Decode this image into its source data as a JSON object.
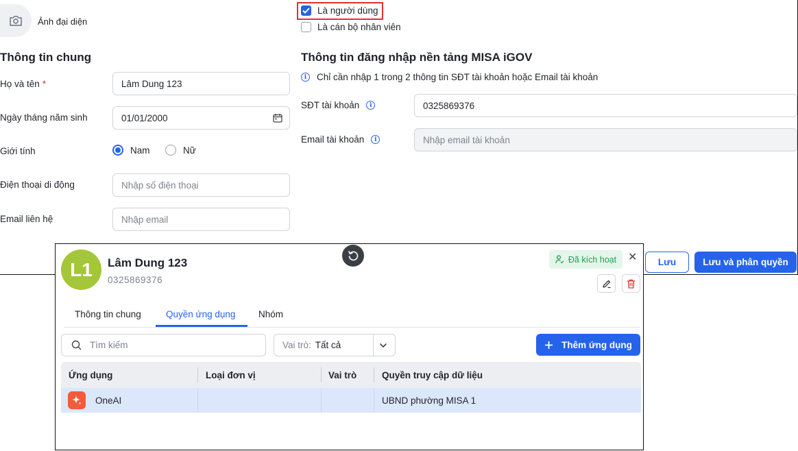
{
  "avatar": {
    "label": "Ảnh đại diện",
    "icon": "camera-icon"
  },
  "user_type": {
    "is_user_label": "Là người dùng",
    "is_user_checked": true,
    "is_staff_label": "Là cán bộ nhân viên",
    "is_staff_checked": false
  },
  "general": {
    "title": "Thông tin chung",
    "full_name_label": "Họ và tên",
    "required_mark": "*",
    "full_name_value": "Lâm Dung 123",
    "dob_label": "Ngày tháng năm sinh",
    "dob_value": "01/01/2000",
    "gender_label": "Giới tính",
    "gender_male": "Nam",
    "gender_female": "Nữ",
    "gender_selected": "Nam",
    "mobile_label": "Điện thoại di động",
    "mobile_placeholder": "Nhập số điện thoại",
    "email_label": "Email liên hệ",
    "email_placeholder": "Nhập email"
  },
  "login": {
    "title": "Thông tin đăng nhập nền tảng MISA iGOV",
    "hint": "Chỉ cần nhập 1 trong 2 thông tin SĐT tài khoản hoặc Email tài khoản",
    "phone_label": "SĐT tài khoản",
    "phone_value": "0325869376",
    "email_label": "Email tài khoản",
    "email_placeholder": "Nhập email tài khoản"
  },
  "actions": {
    "save": "Lưu",
    "save_and_assign": "Lưu và phân quyền"
  },
  "panel": {
    "avatar_initials": "L1",
    "avatar_color": "#a4c639",
    "name": "Lâm Dung 123",
    "phone": "0325869376",
    "status": "Đã kích hoạt",
    "tabs": [
      "Thông tin chung",
      "Quyền ứng dụng",
      "Nhóm"
    ],
    "active_tab": "Quyền ứng dụng",
    "search_placeholder": "Tìm kiếm",
    "role_filter_label": "Vai trò:",
    "role_filter_value": "Tất cả",
    "add_app_label": "Thêm ứng dụng",
    "table": {
      "headers": [
        "Ứng dụng",
        "Loại đơn vị",
        "Vai trò",
        "Quyền truy cập dữ liệu"
      ],
      "rows": [
        {
          "app": "OneAI",
          "unit_type": "",
          "role": "",
          "data_access": "UBND phường MISA 1"
        }
      ]
    }
  },
  "colors": {
    "primary": "#2563eb",
    "required": "#e03131",
    "active_status": "#1f9d55"
  }
}
